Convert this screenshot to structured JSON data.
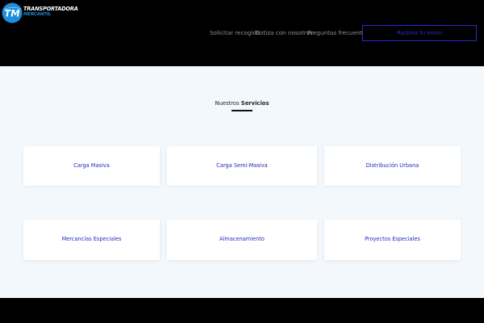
{
  "header": {
    "logo": {
      "mark": "TM",
      "line1": "TRANSPORTADORA",
      "line2": "MERCANTIL"
    },
    "nav": {
      "items": [
        "Solicitar recogida",
        "Cotiza con nosotros",
        "Preguntas frecuentes"
      ],
      "cta_label": "Rastrea tu envío"
    }
  },
  "services": {
    "title_prefix": "Nuestros",
    "title_bold": "Servicios",
    "cards": [
      "Carga Masiva",
      "Carga Semi-Masiva",
      "Distribución Urbana",
      "Mercancías Especiales",
      "Almacenamiento",
      "Proyectos Especiales"
    ]
  },
  "colors": {
    "header_bg": "#000000",
    "page_bg": "#f3f8fd",
    "accent_blue": "#2629c2",
    "logo_blue": "#1e8bdc"
  }
}
